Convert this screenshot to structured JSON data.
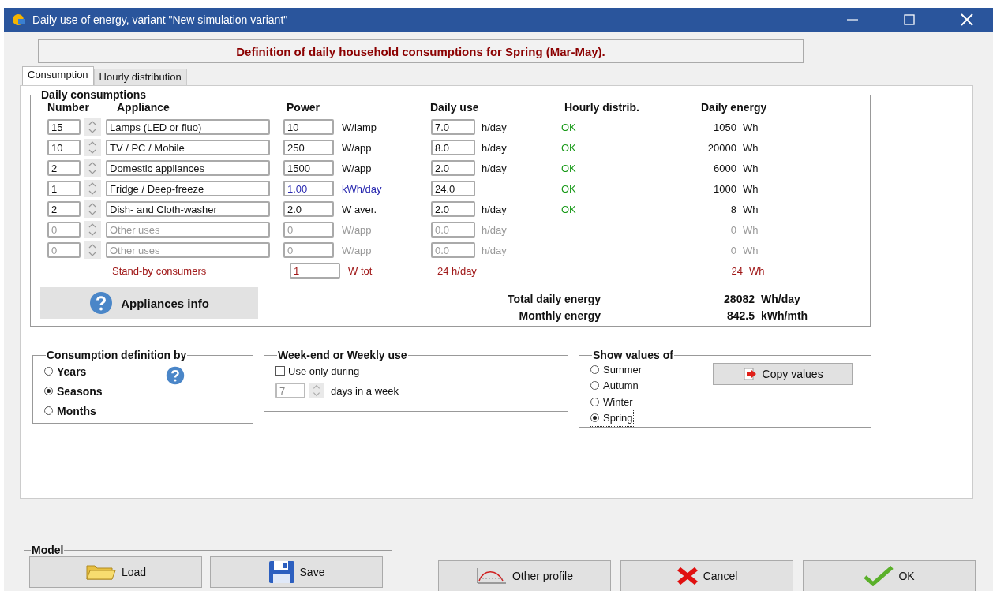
{
  "window": {
    "title": "Daily use of energy, variant \"New simulation variant\""
  },
  "header": "Definition of daily household consumptions for Spring (Mar-May).",
  "tabs": [
    {
      "label": "Consumption",
      "selected": true
    },
    {
      "label": "Hourly distribution",
      "selected": false
    }
  ],
  "daily_consumptions": {
    "title": "Daily consumptions",
    "columns": [
      "Number",
      "Appliance",
      "Power",
      "Daily use",
      "Hourly distrib.",
      "Daily energy"
    ],
    "rows": [
      {
        "kind": "normal",
        "number": "15",
        "appliance": "Lamps (LED or fluo)",
        "power": "10",
        "power_unit": "W/lamp",
        "daily_use": "7.0",
        "daily_unit": "h/day",
        "hourly": "OK",
        "energy": "1050",
        "energy_unit": "Wh"
      },
      {
        "kind": "normal",
        "number": "10",
        "appliance": "TV / PC / Mobile",
        "power": "250",
        "power_unit": "W/app",
        "daily_use": "8.0",
        "daily_unit": "h/day",
        "hourly": "OK",
        "energy": "20000",
        "energy_unit": "Wh"
      },
      {
        "kind": "normal",
        "number": "2",
        "appliance": "Domestic appliances",
        "power": "1500",
        "power_unit": "W/app",
        "daily_use": "2.0",
        "daily_unit": "h/day",
        "hourly": "OK",
        "energy": "6000",
        "energy_unit": "Wh"
      },
      {
        "kind": "energy",
        "number": "1",
        "appliance": "Fridge / Deep-freeze",
        "power": "1.00",
        "power_unit": "kWh/day",
        "daily_use": "24.0",
        "hourly": "OK",
        "energy": "1000",
        "energy_unit": "Wh"
      },
      {
        "kind": "normal",
        "number": "2",
        "appliance": "Dish- and Cloth-washer",
        "power": "2.0",
        "power_unit": "W aver.",
        "daily_use": "2.0",
        "daily_unit": "h/day",
        "hourly": "OK",
        "energy": "8",
        "energy_unit": "Wh"
      },
      {
        "kind": "unused",
        "number": "0",
        "appliance": "Other uses",
        "power": "0",
        "power_unit": "W/app",
        "daily_use": "0.0",
        "daily_unit": "h/day",
        "energy": "0",
        "energy_unit": "Wh"
      },
      {
        "kind": "unused",
        "number": "0",
        "appliance": "Other uses",
        "power": "0",
        "power_unit": "W/app",
        "daily_use": "0.0",
        "daily_unit": "h/day",
        "energy": "0",
        "energy_unit": "Wh"
      }
    ],
    "standby": {
      "label": "Stand-by consumers",
      "power": "1",
      "power_unit": "W tot",
      "daily_use": "24 h/day",
      "energy": "24",
      "energy_unit": "Wh"
    },
    "info_button": "Appliances info",
    "totals": [
      {
        "label": "Total daily energy",
        "value": "28082",
        "unit": "Wh/day"
      },
      {
        "label": "Monthly energy",
        "value": "842.5",
        "unit": "kWh/mth"
      }
    ]
  },
  "definition": {
    "title": "Consumption definition by",
    "options": [
      {
        "label": "Years",
        "selected": false
      },
      {
        "label": "Seasons",
        "selected": true
      },
      {
        "label": "Months",
        "selected": false
      }
    ]
  },
  "weekly": {
    "title": "Week-end or Weekly use",
    "checkbox": {
      "label": "Use only during",
      "checked": false
    },
    "days": {
      "value": "7",
      "disabled": true,
      "label": "days in a week"
    }
  },
  "show_values": {
    "title": "Show values of",
    "options": [
      {
        "label": "Summer",
        "selected": false
      },
      {
        "label": "Autumn",
        "selected": false
      },
      {
        "label": "Winter",
        "selected": false
      },
      {
        "label": "Spring",
        "selected": true
      }
    ],
    "copy_button": "Copy values"
  },
  "model": {
    "title": "Model",
    "buttons": [
      {
        "kind": "load",
        "label": "Load"
      },
      {
        "kind": "save",
        "label": "Save"
      }
    ]
  },
  "buttons": [
    {
      "kind": "profile",
      "label": "Other profile"
    },
    {
      "kind": "cancel",
      "label": "Cancel"
    },
    {
      "kind": "ok",
      "label": "OK"
    }
  ]
}
